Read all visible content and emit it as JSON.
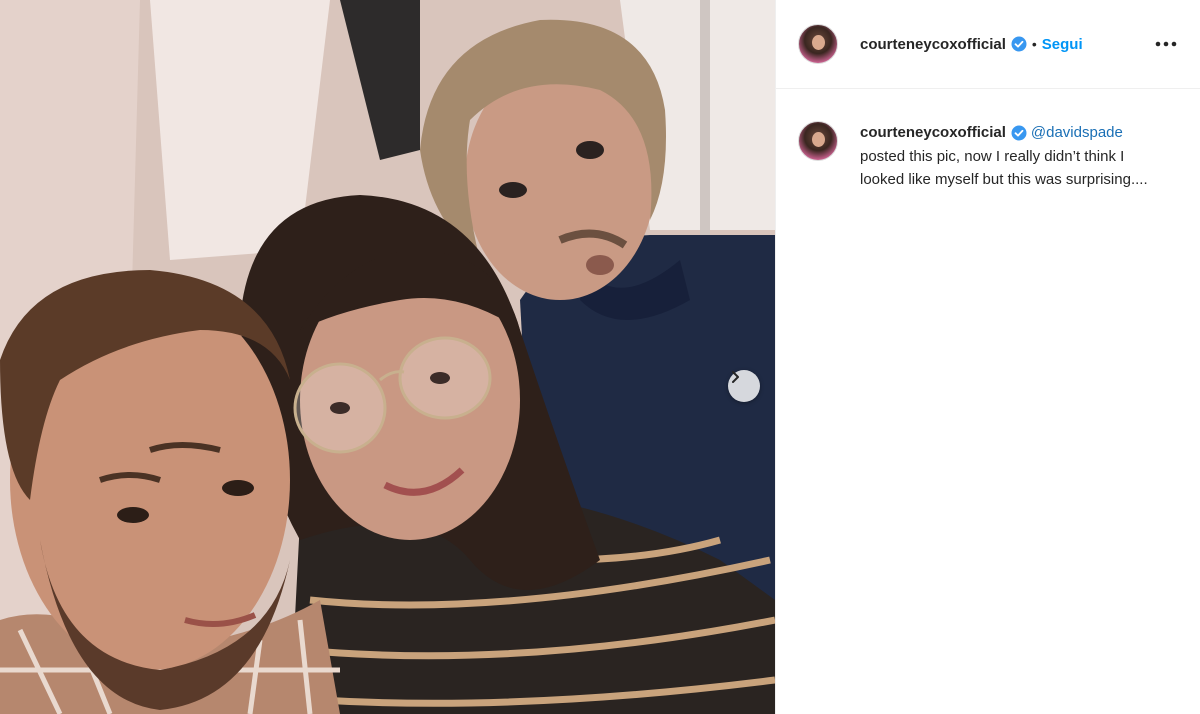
{
  "post": {
    "image_alt": "Selfie of three people",
    "next_icon": "chevron-right-icon"
  },
  "header": {
    "username": "courteneycoxofficial",
    "verified_icon": "verified-badge-icon",
    "separator": "•",
    "follow_label": "Segui",
    "more_icon": "more-horizontal-icon"
  },
  "caption": {
    "username": "courteneycoxofficial",
    "mention": "@davidspade",
    "text": "posted this pic, now I really didn’t think I looked like myself but this was surprising...."
  },
  "colors": {
    "accent": "#0095f6",
    "mention": "#1a6fb5",
    "verified": "#3897f0"
  }
}
